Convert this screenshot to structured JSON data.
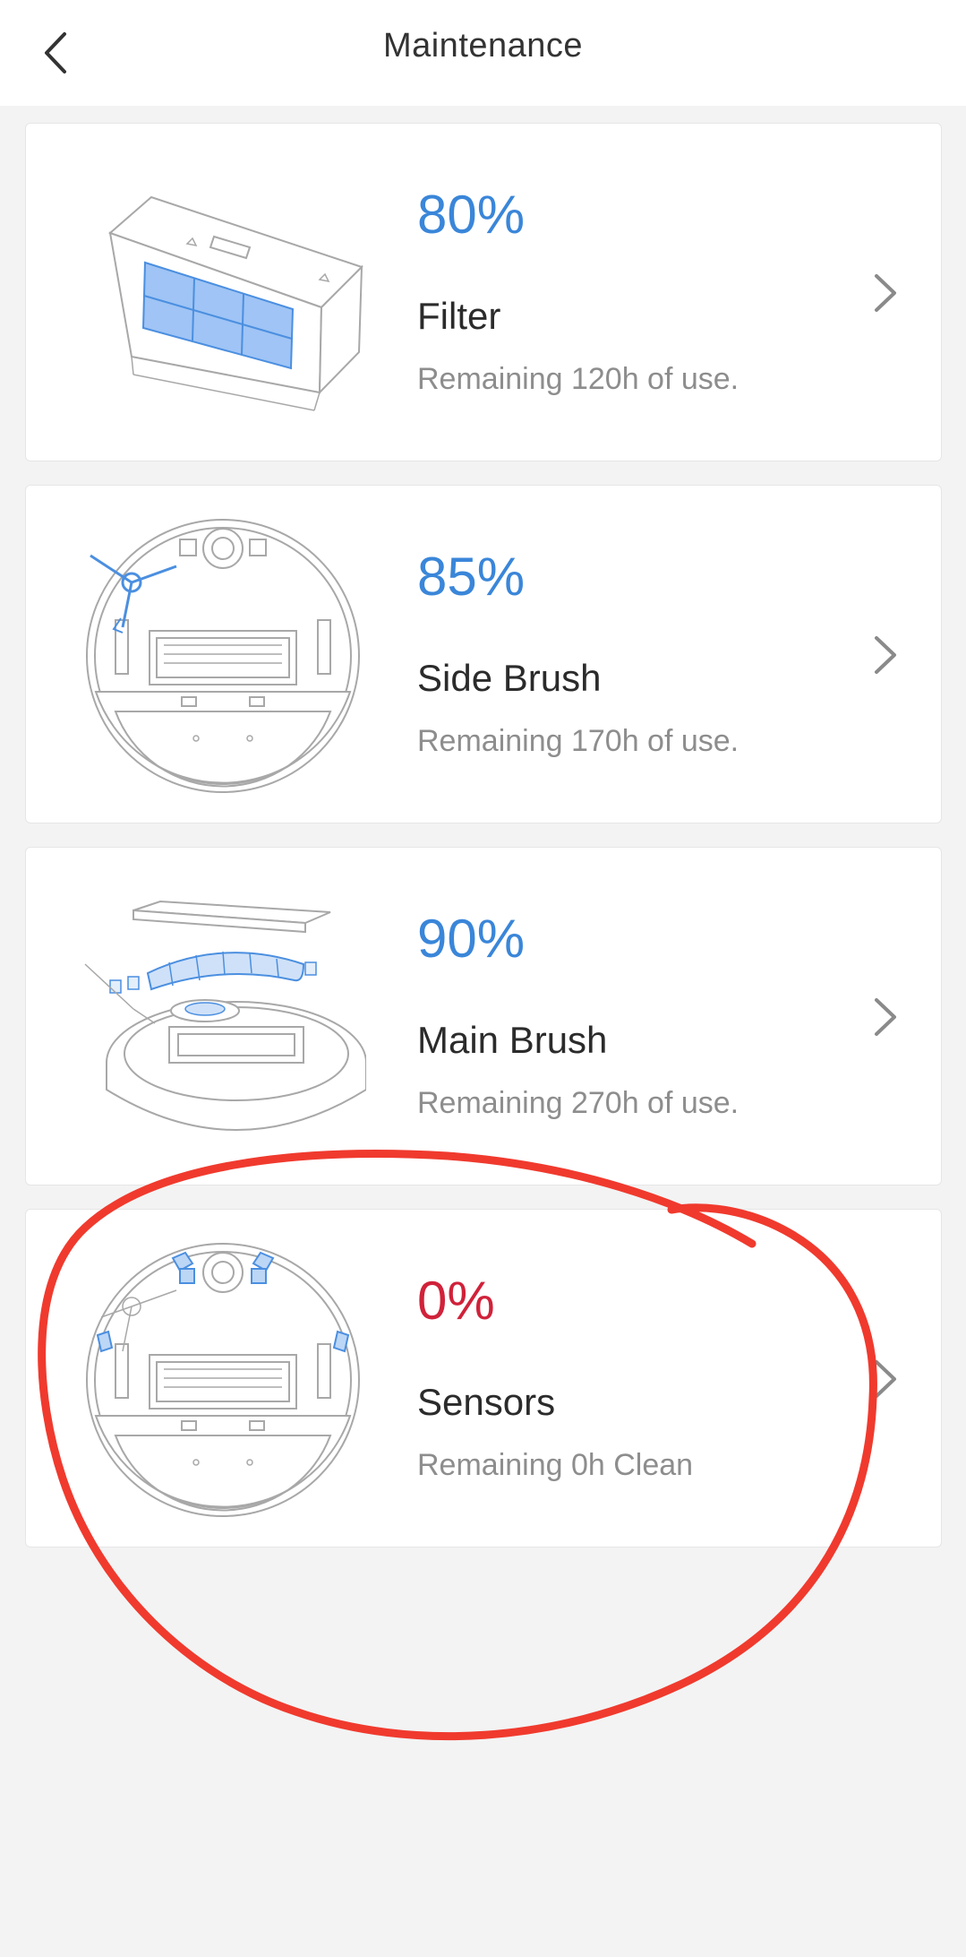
{
  "header": {
    "title": "Maintenance",
    "back_icon": "chevron-left-icon"
  },
  "items": [
    {
      "percent": "80%",
      "name": "Filter",
      "remaining": "Remaining 120h of use.",
      "level": 0.8,
      "status_color": "#3a86d9",
      "illustration": "filter-illustration"
    },
    {
      "percent": "85%",
      "name": "Side Brush",
      "remaining": "Remaining 170h of use.",
      "level": 0.85,
      "status_color": "#3a86d9",
      "illustration": "robot-bottom-illustration"
    },
    {
      "percent": "90%",
      "name": "Main Brush",
      "remaining": "Remaining 270h of use.",
      "level": 0.9,
      "status_color": "#3a86d9",
      "illustration": "main-brush-illustration"
    },
    {
      "percent": "0%",
      "name": "Sensors",
      "remaining": "Remaining 0h Clean",
      "level": 0.0,
      "status_color": "#d0223a",
      "illustration": "robot-sensors-illustration"
    }
  ],
  "colors": {
    "accent": "#3a86d9",
    "alert": "#d0223a",
    "annotation": "#f03a2e",
    "background": "#f3f3f3"
  }
}
